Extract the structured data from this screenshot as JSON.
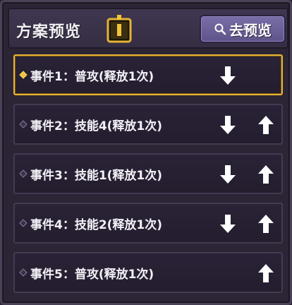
{
  "header": {
    "title": "方案预览",
    "preview_button": "去预览"
  },
  "events": [
    {
      "label": "事件1：普攻(释放1次)",
      "active": true,
      "down": true,
      "up": false
    },
    {
      "label": "事件2：技能4(释放1次)",
      "active": false,
      "down": true,
      "up": true
    },
    {
      "label": "事件3：技能1(释放1次)",
      "active": false,
      "down": true,
      "up": true
    },
    {
      "label": "事件4：技能2(释放1次)",
      "active": false,
      "down": true,
      "up": true
    },
    {
      "label": "事件5：普攻(释放1次)",
      "active": false,
      "down": false,
      "up": true
    }
  ],
  "colors": {
    "accent_gold": "#e6b433",
    "button_purple": "#6c619a",
    "panel_bg": "#2b2535"
  },
  "icons": {
    "info": "info-icon",
    "search": "search-icon",
    "down": "arrow-down-icon",
    "up": "arrow-up-icon"
  }
}
